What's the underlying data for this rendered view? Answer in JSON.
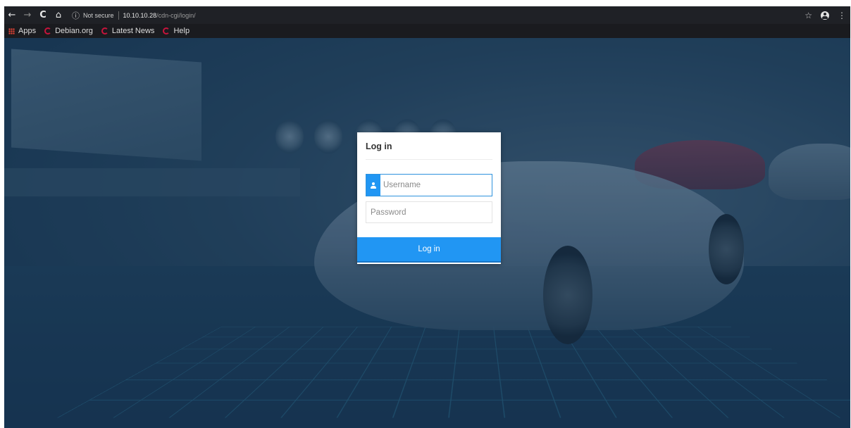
{
  "browser": {
    "nav": {
      "back": "←",
      "forward": "→",
      "reload": "C",
      "home": "⌂"
    },
    "address": {
      "info_icon": "ⓘ",
      "security_label": "Not secure",
      "url_host": "10.10.10.28",
      "url_path": "/cdn-cgi/login/"
    },
    "right": {
      "star": "☆",
      "menu": "⋮"
    },
    "bookmarks": [
      {
        "label": "Apps",
        "icon": "apps-icon"
      },
      {
        "label": "Debian.org",
        "icon": "debian-icon"
      },
      {
        "label": "Latest News",
        "icon": "debian-icon"
      },
      {
        "label": "Help",
        "icon": "debian-icon"
      }
    ]
  },
  "login": {
    "title": "Log in",
    "username_placeholder": "Username",
    "password_placeholder": "Password",
    "submit_label": "Log in"
  },
  "colors": {
    "accent": "#2196f3",
    "overlay": "#1d3a55"
  }
}
